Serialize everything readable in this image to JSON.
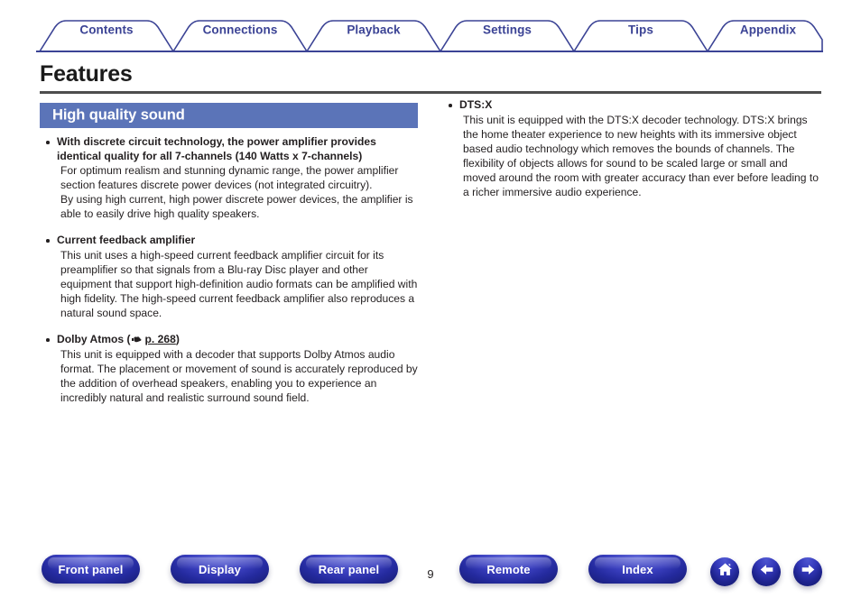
{
  "nav": {
    "tabs": [
      {
        "label": "Contents"
      },
      {
        "label": "Connections"
      },
      {
        "label": "Playback"
      },
      {
        "label": "Settings"
      },
      {
        "label": "Tips"
      },
      {
        "label": "Appendix"
      }
    ]
  },
  "page": {
    "title": "Features",
    "number": "9"
  },
  "section": {
    "heading": "High quality sound"
  },
  "left_column": [
    {
      "heading": "With discrete circuit technology, the power amplifier provides identical quality for all 7-channels (140 Watts x 7-channels)",
      "paragraphs": [
        "For optimum realism and stunning dynamic range, the power amplifier section features discrete power devices (not integrated circuitry).",
        "By using high current, high power discrete power devices, the amplifier is able to easily drive high quality speakers."
      ]
    },
    {
      "heading": "Current feedback amplifier",
      "paragraphs": [
        "This unit uses a high-speed current feedback amplifier circuit for its preamplifier so that signals from a Blu-ray Disc player and other equipment that support high-definition audio formats can be amplified with high fidelity. The high-speed current feedback amplifier also reproduces a natural sound space."
      ]
    },
    {
      "heading_prefix": "Dolby Atmos (",
      "heading_ref": "p. 268",
      "heading_suffix": ")",
      "ref_icon": "pointing-hand-icon",
      "paragraphs": [
        "This unit is equipped with a decoder that supports Dolby Atmos audio format. The placement or movement of sound is accurately reproduced by the addition of overhead speakers, enabling you to experience an incredibly natural and realistic surround sound field."
      ]
    }
  ],
  "right_column": [
    {
      "heading": "DTS:X",
      "paragraphs": [
        "This unit is equipped with the DTS:X decoder technology. DTS:X brings the home theater experience to new heights with its immersive object based audio technology which removes the bounds of channels. The flexibility of objects allows for sound to be scaled large or small and moved around the room with greater accuracy than ever before leading to a richer immersive audio experience."
      ]
    }
  ],
  "footer": {
    "buttons": [
      {
        "label": "Front panel"
      },
      {
        "label": "Display"
      },
      {
        "label": "Rear panel"
      },
      {
        "label": "Remote"
      },
      {
        "label": "Index"
      }
    ],
    "icons": [
      {
        "name": "home-icon"
      },
      {
        "name": "arrow-left-icon"
      },
      {
        "name": "arrow-right-icon"
      }
    ]
  },
  "colors": {
    "tab_outline": "#3b4395",
    "band": "#5b74b8",
    "rule": "#4d4d4d",
    "button": "#2a30ab",
    "text": "#231f20"
  }
}
